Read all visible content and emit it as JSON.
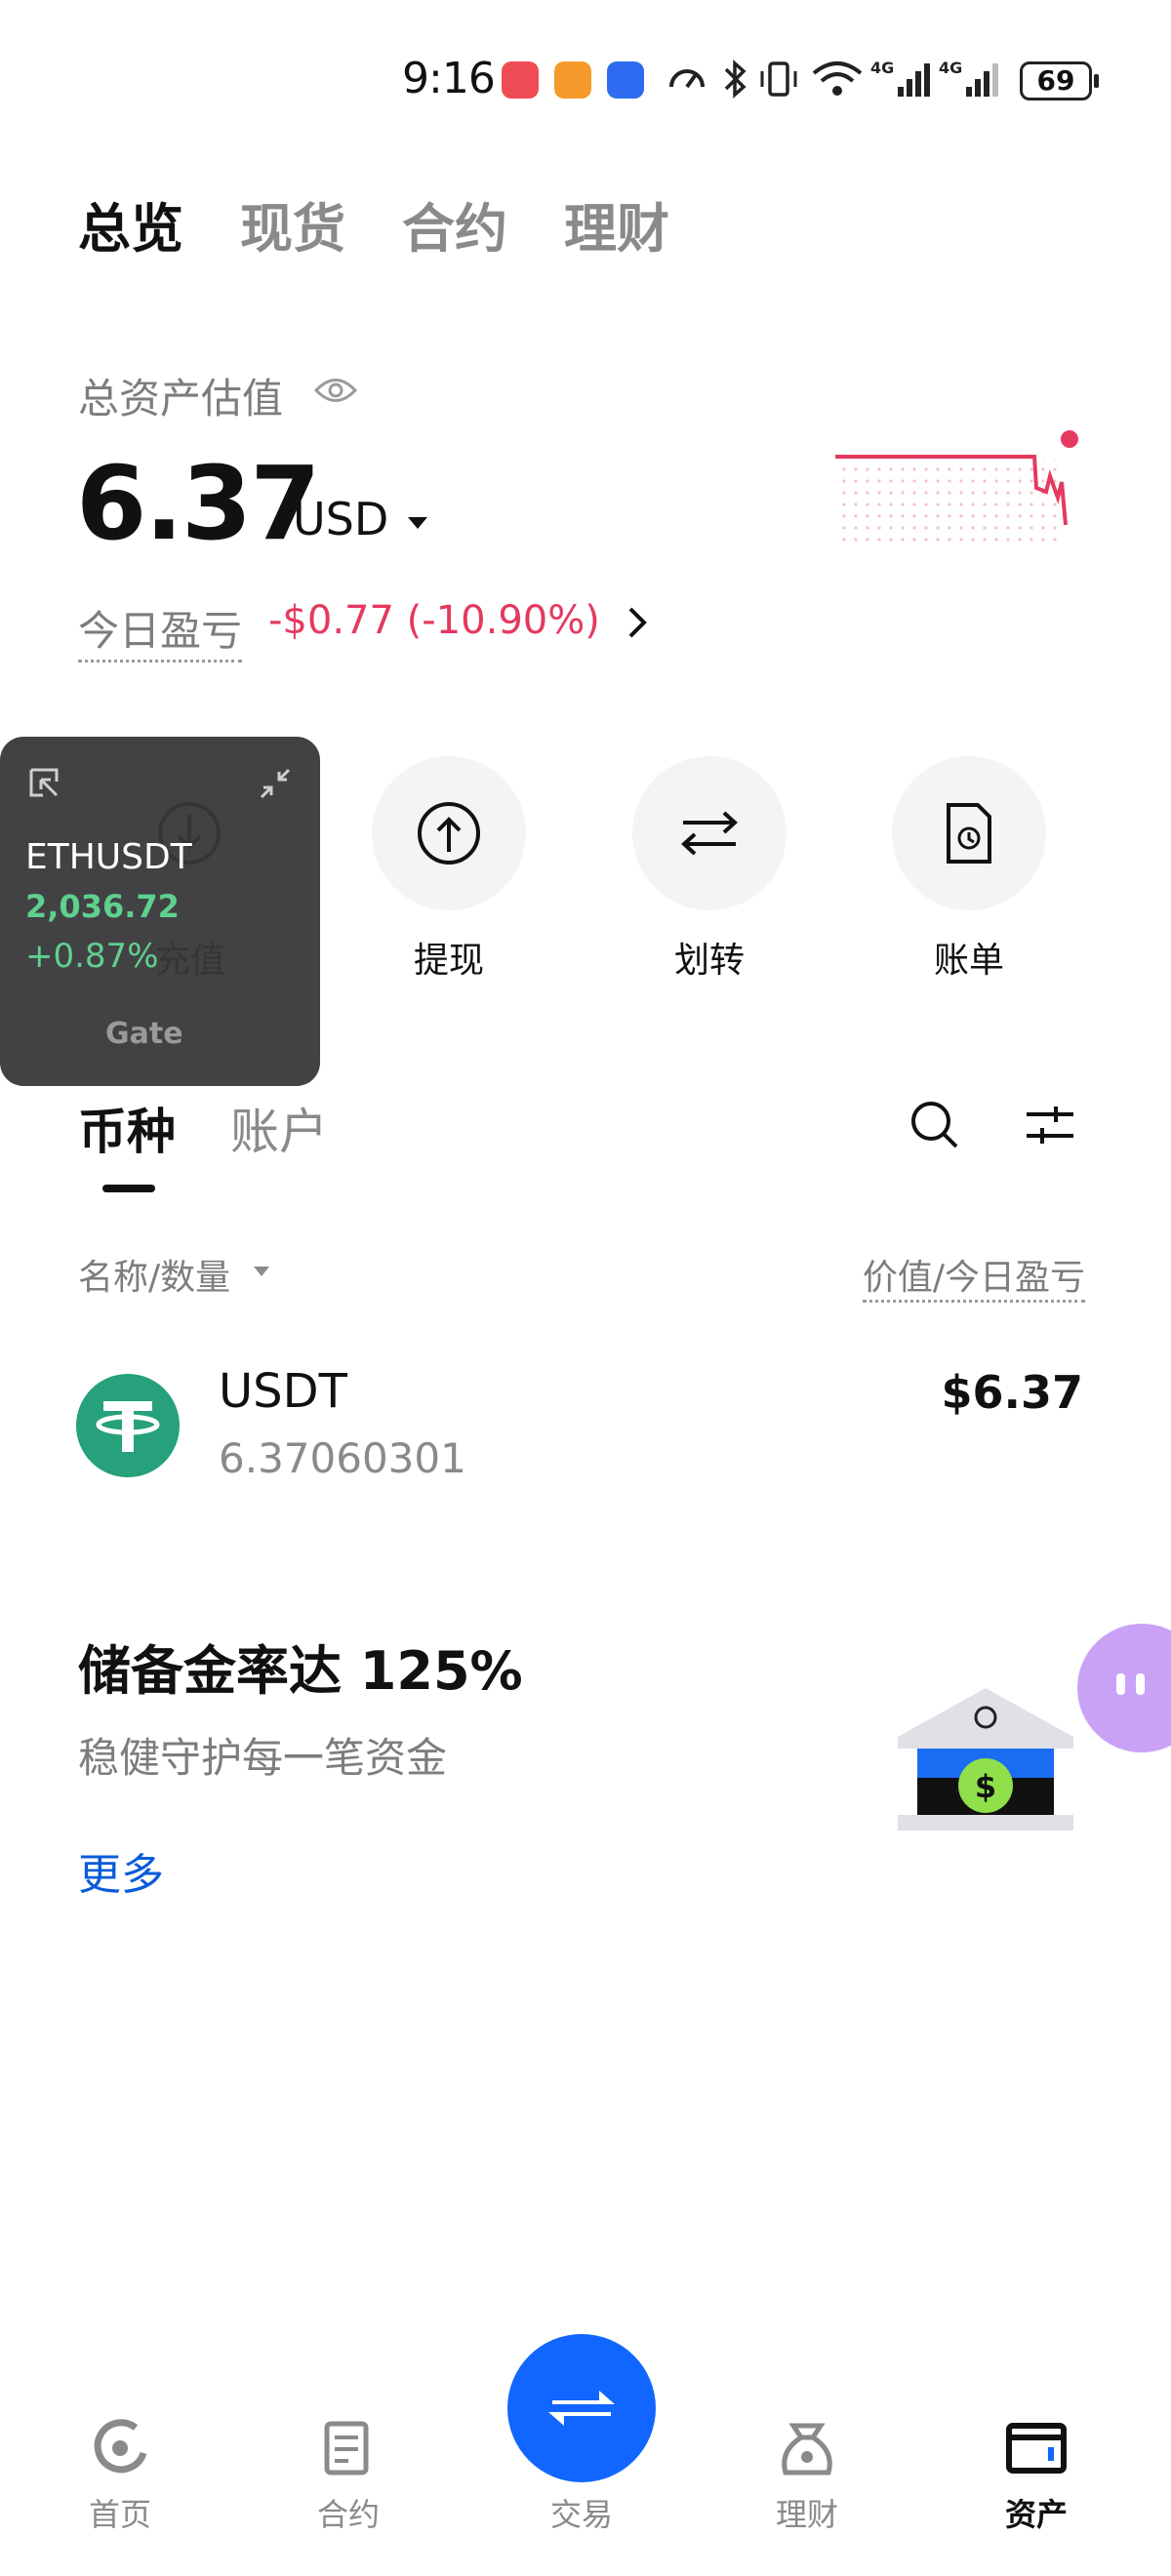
{
  "status_bar": {
    "time": "9:16",
    "battery": "69",
    "network_1": "4G",
    "network_2": "4G"
  },
  "top_tabs": [
    "总览",
    "现货",
    "合约",
    "理财"
  ],
  "overview": {
    "label": "总资产估值",
    "total_value": "6.37",
    "currency": "USD",
    "pnl_label": "今日盈亏",
    "pnl_value": "-$0.77 (-10.90%)"
  },
  "actions": [
    {
      "label": "充值",
      "icon": "download-icon"
    },
    {
      "label": "提现",
      "icon": "upload-icon"
    },
    {
      "label": "划转",
      "icon": "transfer-icon"
    },
    {
      "label": "账单",
      "icon": "bill-icon"
    }
  ],
  "widget": {
    "pair": "ETHUSDT",
    "price": "2,036.72",
    "change": "+0.87%",
    "brand": "Gate"
  },
  "list_tabs": [
    "币种",
    "账户"
  ],
  "columns": {
    "left": "名称/数量",
    "right": "价值/今日盈亏"
  },
  "holdings": [
    {
      "symbol": "USDT",
      "amount": "6.37060301",
      "value": "$6.37"
    }
  ],
  "reserve": {
    "title": "储备金率达 125%",
    "subtitle": "稳健守护每一笔资金",
    "more": "更多"
  },
  "bottom_nav": [
    {
      "label": "首页",
      "active": false
    },
    {
      "label": "合约",
      "active": false
    },
    {
      "label": "交易",
      "active": false
    },
    {
      "label": "理财",
      "active": false
    },
    {
      "label": "资产",
      "active": true
    }
  ],
  "colors": {
    "accent": "#1166ff",
    "loss": "#e5395f",
    "gain": "#5fd08e",
    "usdt": "#26a17b"
  }
}
